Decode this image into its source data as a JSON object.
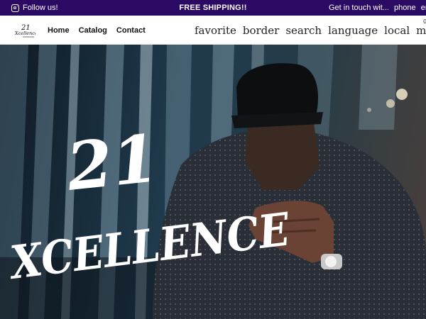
{
  "announcement": {
    "follow_label": "Follow us!",
    "shipping_label": "FREE SHIPPING!!",
    "contact_label": "Get in touch wit...",
    "phone_label": "phone",
    "email_label": "ema"
  },
  "header": {
    "logo_title": "21",
    "logo_subtitle": "Xcellence",
    "nav": [
      "Home",
      "Catalog",
      "Contact"
    ],
    "icons": [
      "favorite",
      "border",
      "search",
      "language",
      "local",
      "mall"
    ],
    "cart_count": "0"
  },
  "hero": {
    "title_number": "21",
    "title_word": "XCELLENCE"
  },
  "colors": {
    "topbar_bg": "#2b0a63",
    "header_bg": "#ffffff"
  }
}
